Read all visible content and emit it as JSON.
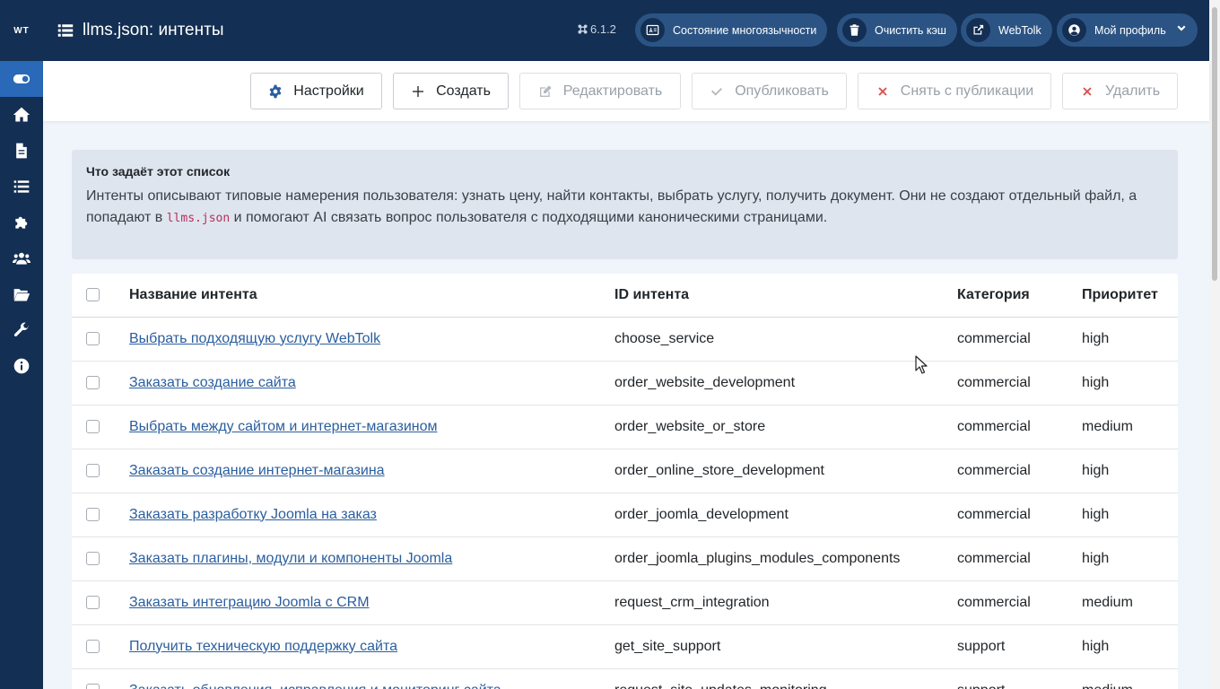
{
  "sidebar": {
    "logo": "WT",
    "items": [
      {
        "icon": "toggle-icon",
        "active": true
      },
      {
        "icon": "home-icon"
      },
      {
        "icon": "file-icon"
      },
      {
        "icon": "list-icon"
      },
      {
        "icon": "puzzle-icon"
      },
      {
        "icon": "users-icon"
      },
      {
        "icon": "folder-open-icon"
      },
      {
        "icon": "wrench-icon"
      },
      {
        "icon": "info-icon"
      }
    ]
  },
  "header": {
    "title": "llms.json: интенты",
    "version": "6.1.2",
    "buttons": {
      "multilang": "Состояние многоязычности",
      "clear_cache": "Очистить кэш",
      "webtolk": "WebTolk",
      "profile": "Мой профиль"
    }
  },
  "toolbar": {
    "settings": "Настройки",
    "create": "Создать",
    "edit": "Редактировать",
    "publish": "Опубликовать",
    "unpublish": "Снять с публикации",
    "delete": "Удалить"
  },
  "alert": {
    "title": "Что задаёт этот список",
    "text_before": "Интенты описывают типовые намерения пользователя: узнать цену, найти контакты, выбрать услугу, получить документ. Они не создают отдельный файл, а попадают в ",
    "code": "llms.json",
    "text_after": " и помогают AI связать вопрос пользователя с подходящими каноническими страницами."
  },
  "table": {
    "columns": {
      "name": "Название интента",
      "id": "ID интента",
      "category": "Категория",
      "priority": "Приоритет"
    },
    "rows": [
      {
        "name": "Выбрать подходящую услугу WebTolk",
        "id": "choose_service",
        "category": "commercial",
        "priority": "high"
      },
      {
        "name": "Заказать создание сайта",
        "id": "order_website_development",
        "category": "commercial",
        "priority": "high"
      },
      {
        "name": "Выбрать между сайтом и интернет-магазином",
        "id": "order_website_or_store",
        "category": "commercial",
        "priority": "medium"
      },
      {
        "name": "Заказать создание интернет-магазина",
        "id": "order_online_store_development",
        "category": "commercial",
        "priority": "high"
      },
      {
        "name": "Заказать разработку Joomla на заказ",
        "id": "order_joomla_development",
        "category": "commercial",
        "priority": "high"
      },
      {
        "name": "Заказать плагины, модули и компоненты Joomla",
        "id": "order_joomla_plugins_modules_components",
        "category": "commercial",
        "priority": "high"
      },
      {
        "name": "Заказать интеграцию Joomla с CRM",
        "id": "request_crm_integration",
        "category": "commercial",
        "priority": "medium"
      },
      {
        "name": "Получить техническую поддержку сайта",
        "id": "get_site_support",
        "category": "support",
        "priority": "high"
      },
      {
        "name": "Заказать обновления, исправления и мониторинг сайта",
        "id": "request_site_updates_monitoring",
        "category": "support",
        "priority": "medium"
      }
    ]
  }
}
